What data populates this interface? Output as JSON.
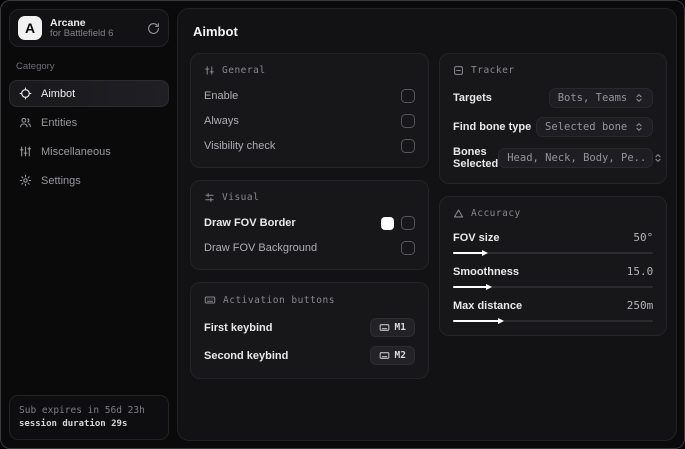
{
  "colors": {
    "window_bg": "#0a0a0b",
    "main_bg": "#121214",
    "panel_bg": "#17171a",
    "text_primary": "#ececee",
    "text_secondary": "#8f8f94",
    "fov_border_swatch": "#ffffff",
    "slider_fill": "#ffffff"
  },
  "brand": {
    "logo_letter": "A",
    "name": "Arcane",
    "subtitle": "for Battlefield 6"
  },
  "sidebar": {
    "category_label": "Category",
    "items": [
      {
        "label": "Aimbot",
        "selected": true
      },
      {
        "label": "Entities",
        "selected": false
      },
      {
        "label": "Miscellaneous",
        "selected": false
      },
      {
        "label": "Settings",
        "selected": false
      }
    ],
    "footer": {
      "line1": "Sub expires in 56d 23h",
      "line2": "session duration 29s"
    }
  },
  "main": {
    "title": "Aimbot",
    "general": {
      "title": "General",
      "rows": [
        {
          "label": "Enable",
          "checked": false
        },
        {
          "label": "Always",
          "checked": false
        },
        {
          "label": "Visibility check",
          "checked": false
        }
      ]
    },
    "visual": {
      "title": "Visual",
      "rows": [
        {
          "label": "Draw FOV Border",
          "swatch_color": "#ffffff",
          "checked": false
        },
        {
          "label": "Draw FOV Background",
          "checked": false
        }
      ]
    },
    "activation": {
      "title": "Activation buttons",
      "rows": [
        {
          "label": "First keybind",
          "key": "M1"
        },
        {
          "label": "Second keybind",
          "key": "M2"
        }
      ]
    },
    "tracker": {
      "title": "Tracker",
      "rows": [
        {
          "label": "Targets",
          "value": "Bots, Teams"
        },
        {
          "label": "Find bone type",
          "value": "Selected bone"
        },
        {
          "label": "Bones Selected",
          "value": "Head, Neck, Body, Pe.."
        }
      ]
    },
    "accuracy": {
      "title": "Accuracy",
      "rows": [
        {
          "label": "FOV size",
          "value": "50°",
          "fill": "15%"
        },
        {
          "label": "Smoothness",
          "value": "15.0",
          "fill": "17%"
        },
        {
          "label": "Max distance",
          "value": "250m",
          "fill": "23%"
        }
      ]
    }
  }
}
